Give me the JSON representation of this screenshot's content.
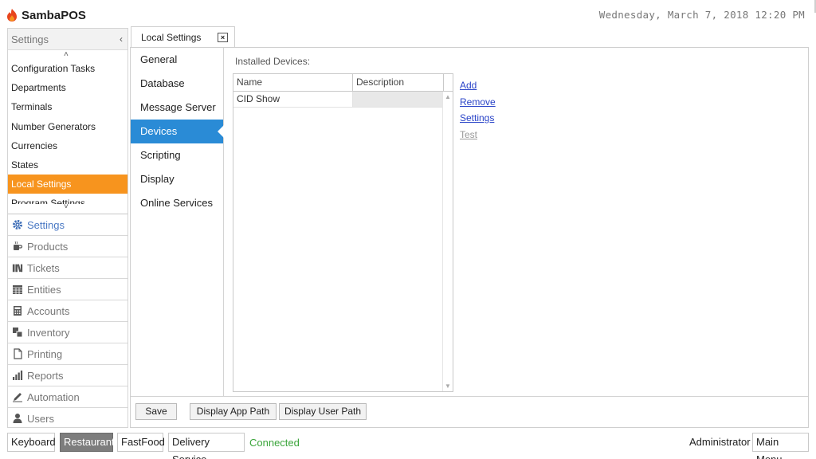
{
  "app": {
    "name": "SambaPOS",
    "datetime": "Wednesday, March 7, 2018 12:20 PM"
  },
  "left_panel": {
    "header": "Settings",
    "collapse_icon": "chevron-left-icon",
    "items": [
      "Configuration Tasks",
      "Departments",
      "Terminals",
      "Number Generators",
      "Currencies",
      "States",
      "Local Settings",
      "Program Settings"
    ],
    "active_item": "Local Settings",
    "modules": [
      "Settings",
      "Products",
      "Tickets",
      "Entities",
      "Accounts",
      "Inventory",
      "Printing",
      "Reports",
      "Automation",
      "Users"
    ],
    "active_module": "Settings"
  },
  "tab": {
    "label": "Local Settings",
    "close": "×"
  },
  "subnav": {
    "items": [
      "General",
      "Database",
      "Message Server",
      "Devices",
      "Scripting",
      "Display",
      "Online Services"
    ],
    "active": "Devices"
  },
  "devices": {
    "label": "Installed Devices:",
    "columns": [
      "Name",
      "Description"
    ],
    "rows": [
      {
        "name": "CID Show",
        "description": ""
      }
    ],
    "actions": [
      "Add",
      "Remove",
      "Settings",
      "Test"
    ]
  },
  "bottom_buttons": [
    "Save",
    "Display App Path",
    "Display User Path"
  ],
  "footer": {
    "buttons": [
      "Keyboard",
      "Restaurant",
      "FastFood",
      "Delivery Service"
    ],
    "active": "Restaurant",
    "status": "Connected",
    "user": "Administrator",
    "main_menu": "Main Menu"
  },
  "colors": {
    "accent_orange": "#f7941e",
    "accent_blue": "#2a8bd6",
    "link_blue": "#2a44c8",
    "status_green": "#3ba53b"
  }
}
